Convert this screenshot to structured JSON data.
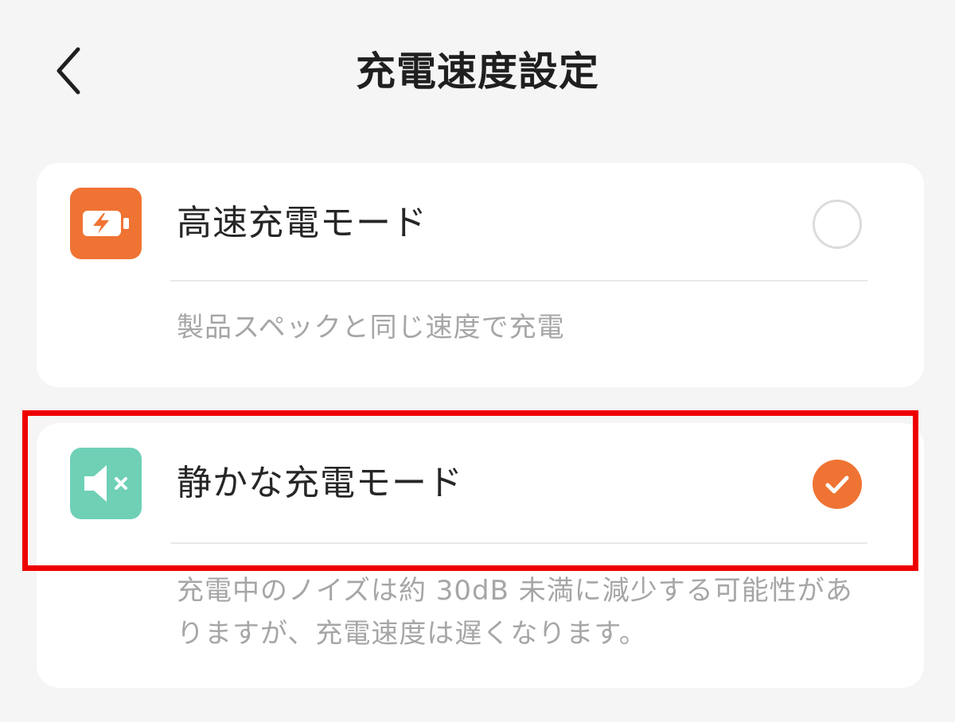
{
  "header": {
    "title": "充電速度設定",
    "back_icon": "chevron-left-icon"
  },
  "modes": [
    {
      "label": "高速充電モード",
      "description": "製品スペックと同じ速度で充電",
      "icon": "battery-bolt-icon",
      "icon_color": "#ef7333",
      "selected": false
    },
    {
      "label": "静かな充電モード",
      "description": "充電中のノイズは約 30dB 未満に減少する可能性がありますが、充電速度は遅くなります。",
      "icon": "speaker-mute-icon",
      "icon_color": "#6fd0b6",
      "selected": true
    }
  ],
  "colors": {
    "accent": "#ef7333",
    "highlight": "#ee0000",
    "background": "#f5f5f5"
  }
}
